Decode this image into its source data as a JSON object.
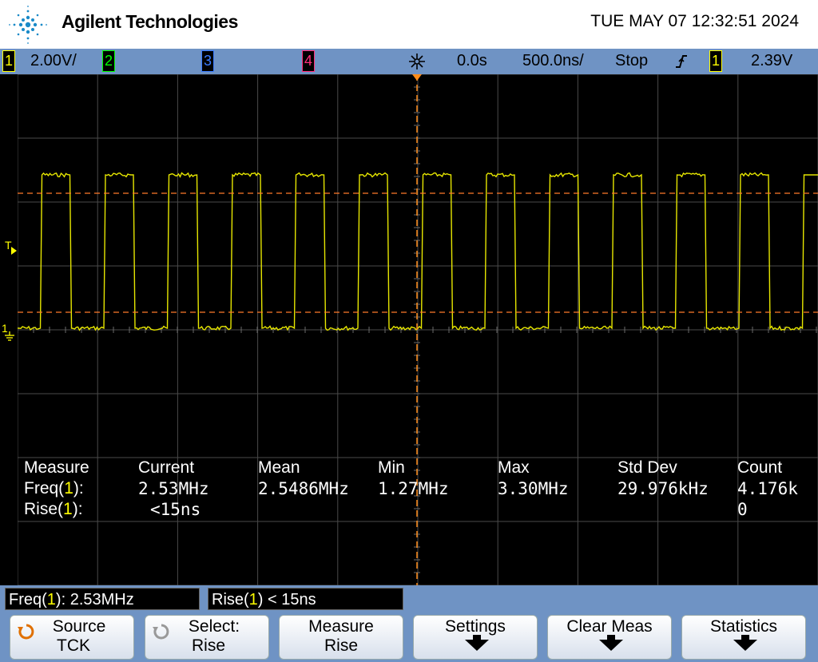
{
  "header": {
    "brand": "Agilent Technologies",
    "datetime": "TUE MAY 07 12:32:51 2024"
  },
  "status": {
    "ch1_num": "1",
    "ch1_scale": "2.00V/",
    "ch2_num": "2",
    "ch3_num": "3",
    "ch4_num": "4",
    "time_delay": "0.0s",
    "time_scale": "500.0ns/",
    "run_state": "Stop",
    "trigger_source": "1",
    "trigger_level": "2.39V",
    "colors": {
      "ch1": "#ffff00",
      "ch2": "#00ff00",
      "ch3": "#3a7bff",
      "ch4": "#ff2d7a"
    }
  },
  "markers": {
    "trigger_marker": "T",
    "ground_marker": "1"
  },
  "measurements": {
    "headers": [
      "Measure",
      "Current",
      "Mean",
      "Min",
      "Max",
      "Std Dev",
      "Count"
    ],
    "rows": [
      {
        "label_prefix": "Freq(",
        "ch": "1",
        "label_suffix": "):",
        "current": "2.53MHz",
        "mean": "2.5486MHz",
        "min": "1.27MHz",
        "max": "3.30MHz",
        "stddev": "29.976kHz",
        "count": "4.176k"
      },
      {
        "label_prefix": "Rise(",
        "ch": "1",
        "label_suffix": "):",
        "current": "<15ns",
        "mean": "",
        "min": "",
        "max": "",
        "stddev": "",
        "count": "0"
      }
    ]
  },
  "results": {
    "freq_prefix": "Freq(",
    "freq_ch": "1",
    "freq_suffix": "): 2.53MHz",
    "rise_prefix": "Rise(",
    "rise_ch": "1",
    "rise_suffix": ") < 15ns"
  },
  "softkeys": {
    "source_l1": "Source",
    "source_l2": "TCK",
    "select_l1": "Select:",
    "select_l2": "Rise",
    "measure_l1": "Measure",
    "measure_l2": "Rise",
    "settings_l1": "Settings",
    "clear_l1": "Clear Meas",
    "stats_l1": "Statistics"
  }
}
